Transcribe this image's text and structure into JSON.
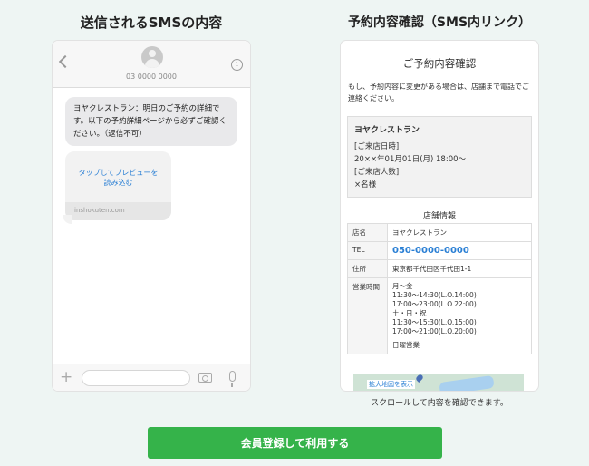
{
  "left_column": {
    "title": "送信されるSMSの内容",
    "phone_number": "03 0000 0000",
    "sms_text": "ヨヤクレストラン：明日のご予約の詳細です。以下の予約詳細ページから必ずご確認ください。（返信不可）",
    "preview_text_1": "タップしてプレビューを",
    "preview_text_2": "読み込む",
    "preview_domain": "inshokuten.com"
  },
  "right_column": {
    "title": "予約内容確認（SMS内リンク）",
    "panel_title": "ご予約内容確認",
    "note": "もし、予約内容に変更がある場合は、店舗まで電話でご連絡ください。",
    "reservation": {
      "restaurant": "ヨヤクレストラン",
      "date_label": "[ご来店日時]",
      "date_value": "20××年01月01日(月) 18:00〜",
      "people_label": "[ご来店人数]",
      "people_value": "×名様"
    },
    "shop_info_heading": "店舗情報",
    "shop_info": {
      "name_label": "店名",
      "name_value": "ヨヤクレストラン",
      "tel_label": "TEL",
      "tel_value": "050-0000-0000",
      "address_label": "住所",
      "address_value": "東京都千代田区千代田1-1",
      "hours_label": "営業時間",
      "hours_lines": [
        "月〜金",
        "11:30〜14:30(L.O.14:00)",
        "17:00〜23:00(L.O.22:00)",
        "土・日・祝",
        "11:30〜15:30(L.O.15:00)",
        "17:00〜21:00(L.O.20:00)"
      ],
      "holiday": "日曜営業"
    },
    "map_label": "拡大地図を表示",
    "scroll_note": "スクロールして内容を確認できます。"
  },
  "register_button": "会員登録して利用する"
}
